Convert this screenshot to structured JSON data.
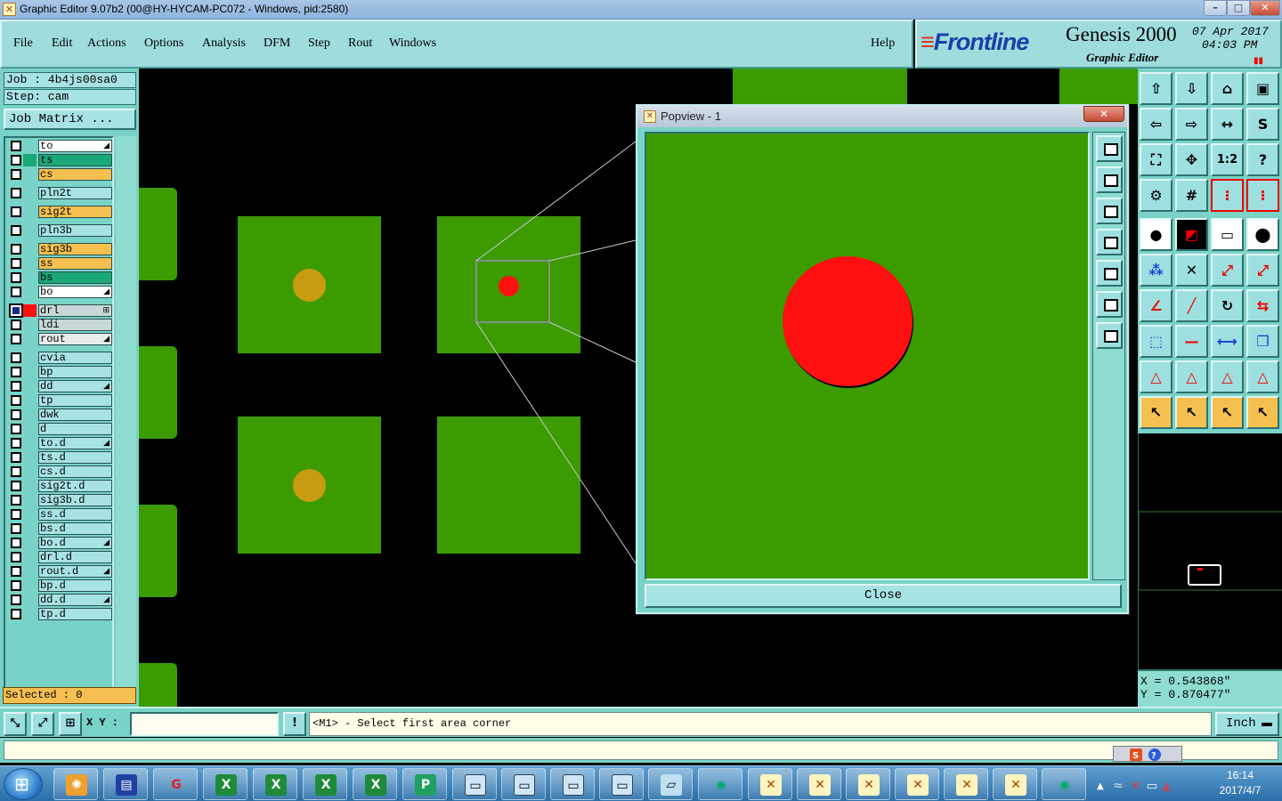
{
  "window": {
    "title": "Graphic Editor 9.07b2 (00@HY-HYCAM-PC072 - Windows, pid:2580)",
    "buttons": [
      "–",
      "□",
      "✕"
    ]
  },
  "menu": {
    "items": [
      "File",
      "Edit",
      "Actions",
      "Options",
      "Analysis",
      "DFM",
      "Step",
      "Rout",
      "Windows"
    ],
    "help": "Help"
  },
  "brand": {
    "logo": "Frontline",
    "product": "Genesis 2000",
    "subtitle": "Graphic Editor",
    "date": "07 Apr 2017",
    "time": "04:03 PM"
  },
  "job": {
    "job_label": "Job : 4b4js00sa0",
    "step_label": "Step: cam",
    "job_matrix": "Job Matrix ..."
  },
  "layers": [
    {
      "name": "to",
      "color": "#ffffff",
      "swatch": ""
    },
    {
      "name": "ts",
      "color": "#1aa878",
      "swatch": "#1aa878"
    },
    {
      "name": "cs",
      "color": "#f6c050",
      "swatch": ""
    },
    {
      "name": "pln2t",
      "color": "#a8e3e3",
      "swatch": ""
    },
    {
      "name": "sig2t",
      "color": "#f6c050",
      "swatch": ""
    },
    {
      "name": "pln3b",
      "color": "#a8e3e3",
      "swatch": ""
    },
    {
      "name": "sig3b",
      "color": "#f6c050",
      "swatch": ""
    },
    {
      "name": "ss",
      "color": "#f6c050",
      "swatch": ""
    },
    {
      "name": "bs",
      "color": "#1aa878",
      "swatch": ""
    },
    {
      "name": "bo",
      "color": "#ffffff",
      "swatch": ""
    },
    {
      "name": "drl",
      "color": "#c8d8d8",
      "swatch": "#ff1010"
    },
    {
      "name": "ldi",
      "color": "#c8d8d8",
      "swatch": ""
    },
    {
      "name": "rout",
      "color": "#e8ecec",
      "swatch": ""
    },
    {
      "name": "cvia",
      "color": "#a8e3e3",
      "swatch": ""
    },
    {
      "name": "bp",
      "color": "#a8e3e3",
      "swatch": ""
    },
    {
      "name": "dd",
      "color": "#a8e3e3",
      "swatch": ""
    },
    {
      "name": "tp",
      "color": "#a8e3e3",
      "swatch": ""
    },
    {
      "name": "dwk",
      "color": "#a8e3e3",
      "swatch": ""
    },
    {
      "name": "d",
      "color": "#a8e3e3",
      "swatch": ""
    },
    {
      "name": "to.d",
      "color": "#a8e3e3",
      "swatch": ""
    },
    {
      "name": "ts.d",
      "color": "#a8e3e3",
      "swatch": ""
    },
    {
      "name": "cs.d",
      "color": "#a8e3e3",
      "swatch": ""
    },
    {
      "name": "sig2t.d",
      "color": "#a8e3e3",
      "swatch": ""
    },
    {
      "name": "sig3b.d",
      "color": "#a8e3e3",
      "swatch": ""
    },
    {
      "name": "ss.d",
      "color": "#a8e3e3",
      "swatch": ""
    },
    {
      "name": "bs.d",
      "color": "#a8e3e3",
      "swatch": ""
    },
    {
      "name": "bo.d",
      "color": "#a8e3e3",
      "swatch": ""
    },
    {
      "name": "drl.d",
      "color": "#a8e3e3",
      "swatch": ""
    },
    {
      "name": "rout.d",
      "color": "#a8e3e3",
      "swatch": ""
    },
    {
      "name": "bp.d",
      "color": "#a8e3e3",
      "swatch": ""
    },
    {
      "name": "dd.d",
      "color": "#a8e3e3",
      "swatch": ""
    },
    {
      "name": "tp.d",
      "color": "#a8e3e3",
      "swatch": ""
    }
  ],
  "selected": "Selected : 0",
  "popview": {
    "title": "Popview - 1",
    "close_label": "Close"
  },
  "coords": {
    "x": "X = 0.543868\"",
    "y": "Y = 0.870477\""
  },
  "command": {
    "xy_label": "X Y :",
    "xy_value": "",
    "prompt": "<M1> - Select first area corner",
    "units": "Inch"
  },
  "clock": {
    "time": "16:14",
    "date": "2017/4/7"
  }
}
